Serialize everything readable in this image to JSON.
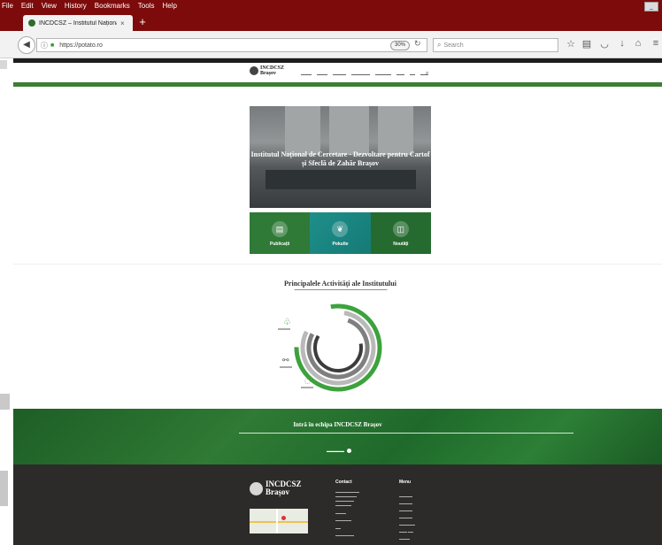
{
  "browser": {
    "menu": [
      "File",
      "Edit",
      "View",
      "History",
      "Bookmarks",
      "Tools",
      "Help"
    ],
    "tab_title": "INCDCSZ – Institutul Național ...",
    "tab_close": "×",
    "new_tab": "+",
    "url": "https://potato.ro",
    "zoom": "30%",
    "search_placeholder": "Search"
  },
  "site": {
    "logo_name": "INCDCSZ",
    "logo_sub": "Brașov",
    "hero_title": "Institutul Național de Cercetare - Dezvoltare pentru Cartof și Sfeclă de Zahăr Brașov",
    "tiles": [
      {
        "label": "Publicații",
        "icon": "book-icon",
        "color": "#2e7a36"
      },
      {
        "label": "Pokulte",
        "icon": "leaf-icon",
        "color": "#1e8f8a"
      },
      {
        "label": "Noutăți",
        "icon": "open-book-icon",
        "color": "#256b30"
      }
    ],
    "activities_title": "Principalele Activități ale Institutului",
    "join_title": "Intră în echipa INCDCSZ Brașov",
    "footer": {
      "contact_title": "Contact",
      "menu_title": "Menu"
    }
  },
  "colors": {
    "titlebar": "#7d0b0b",
    "brand_green": "#3e7d34",
    "footer": "#2d2b29"
  }
}
